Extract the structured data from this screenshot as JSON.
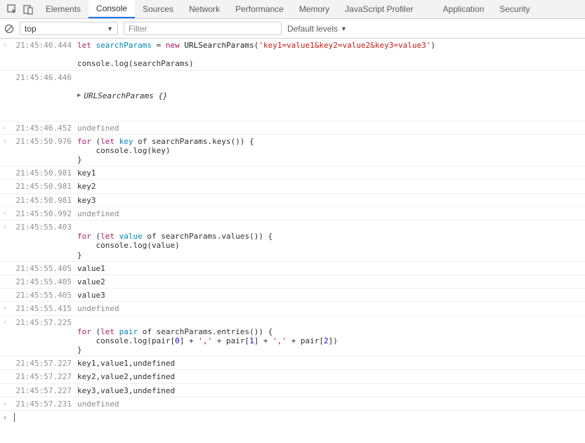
{
  "tabs": {
    "elements": "Elements",
    "console": "Console",
    "sources": "Sources",
    "network": "Network",
    "performance": "Performance",
    "memory": "Memory",
    "jsprofiler": "JavaScript Profiler",
    "application": "Application",
    "security": "Security"
  },
  "toolbar": {
    "context": "top",
    "filter_placeholder": "Filter",
    "levels_label": "Default levels"
  },
  "rows": {
    "r0": {
      "ts": "21:45:46.444"
    },
    "r0_code": {
      "let": "let",
      "searchParams": "searchParams",
      "eq": " = ",
      "new": "new",
      "cls": "URLSearchParams",
      "op": "(",
      "str": "'key1=value1&key2=value2&key3=value3'",
      "cp": ")"
    },
    "r0_line2": "console.log(searchParams)",
    "r1": {
      "ts": "21:45:46.446",
      "obj": "URLSearchParams {}"
    },
    "r2": {
      "ts": "21:45:46.452",
      "txt": "undefined"
    },
    "r3": {
      "ts": "21:45:50.976"
    },
    "r3_code": {
      "for": "for",
      "op": " (",
      "let": "let",
      "key": "key",
      "of": " of ",
      "call": "searchParams.keys()) {",
      "body": "    console.log(key)",
      "end": "}"
    },
    "r4": {
      "ts": "21:45:50.981",
      "txt": "key1"
    },
    "r5": {
      "ts": "21:45:50.981",
      "txt": "key2"
    },
    "r6": {
      "ts": "21:45:50.981",
      "txt": "key3"
    },
    "r7": {
      "ts": "21:45:50.992",
      "txt": "undefined"
    },
    "r8": {
      "ts": "21:45:55.403"
    },
    "r8_code": {
      "for": "for",
      "op": " (",
      "let": "let",
      "val": "value",
      "of": " of ",
      "call": "searchParams.values()) {",
      "body": "    console.log(value)",
      "end": "}"
    },
    "r9": {
      "ts": "21:45:55.405",
      "txt": "value1"
    },
    "r10": {
      "ts": "21:45:55.405",
      "txt": "value2"
    },
    "r11": {
      "ts": "21:45:55.405",
      "txt": "value3"
    },
    "r12": {
      "ts": "21:45:55.415",
      "txt": "undefined"
    },
    "r13": {
      "ts": "21:45:57.225"
    },
    "r13_code": {
      "for": "for",
      "op": " (",
      "let": "let",
      "pair": "pair",
      "of": " of ",
      "call": "searchParams.entries()) {",
      "pre": "    console.log(pair[",
      "n0": "0",
      "mid1": "] + ",
      "s1": "','",
      "mid2": " + pair[",
      "n1": "1",
      "mid3": "] + ",
      "s2": "','",
      "mid4": " + pair[",
      "n2": "2",
      "mid5": "])",
      "end": "}"
    },
    "r14": {
      "ts": "21:45:57.227",
      "txt": "key1,value1,undefined"
    },
    "r15": {
      "ts": "21:45:57.227",
      "txt": "key2,value2,undefined"
    },
    "r16": {
      "ts": "21:45:57.227",
      "txt": "key3,value3,undefined"
    },
    "r17": {
      "ts": "21:45:57.231",
      "txt": "undefined"
    }
  }
}
